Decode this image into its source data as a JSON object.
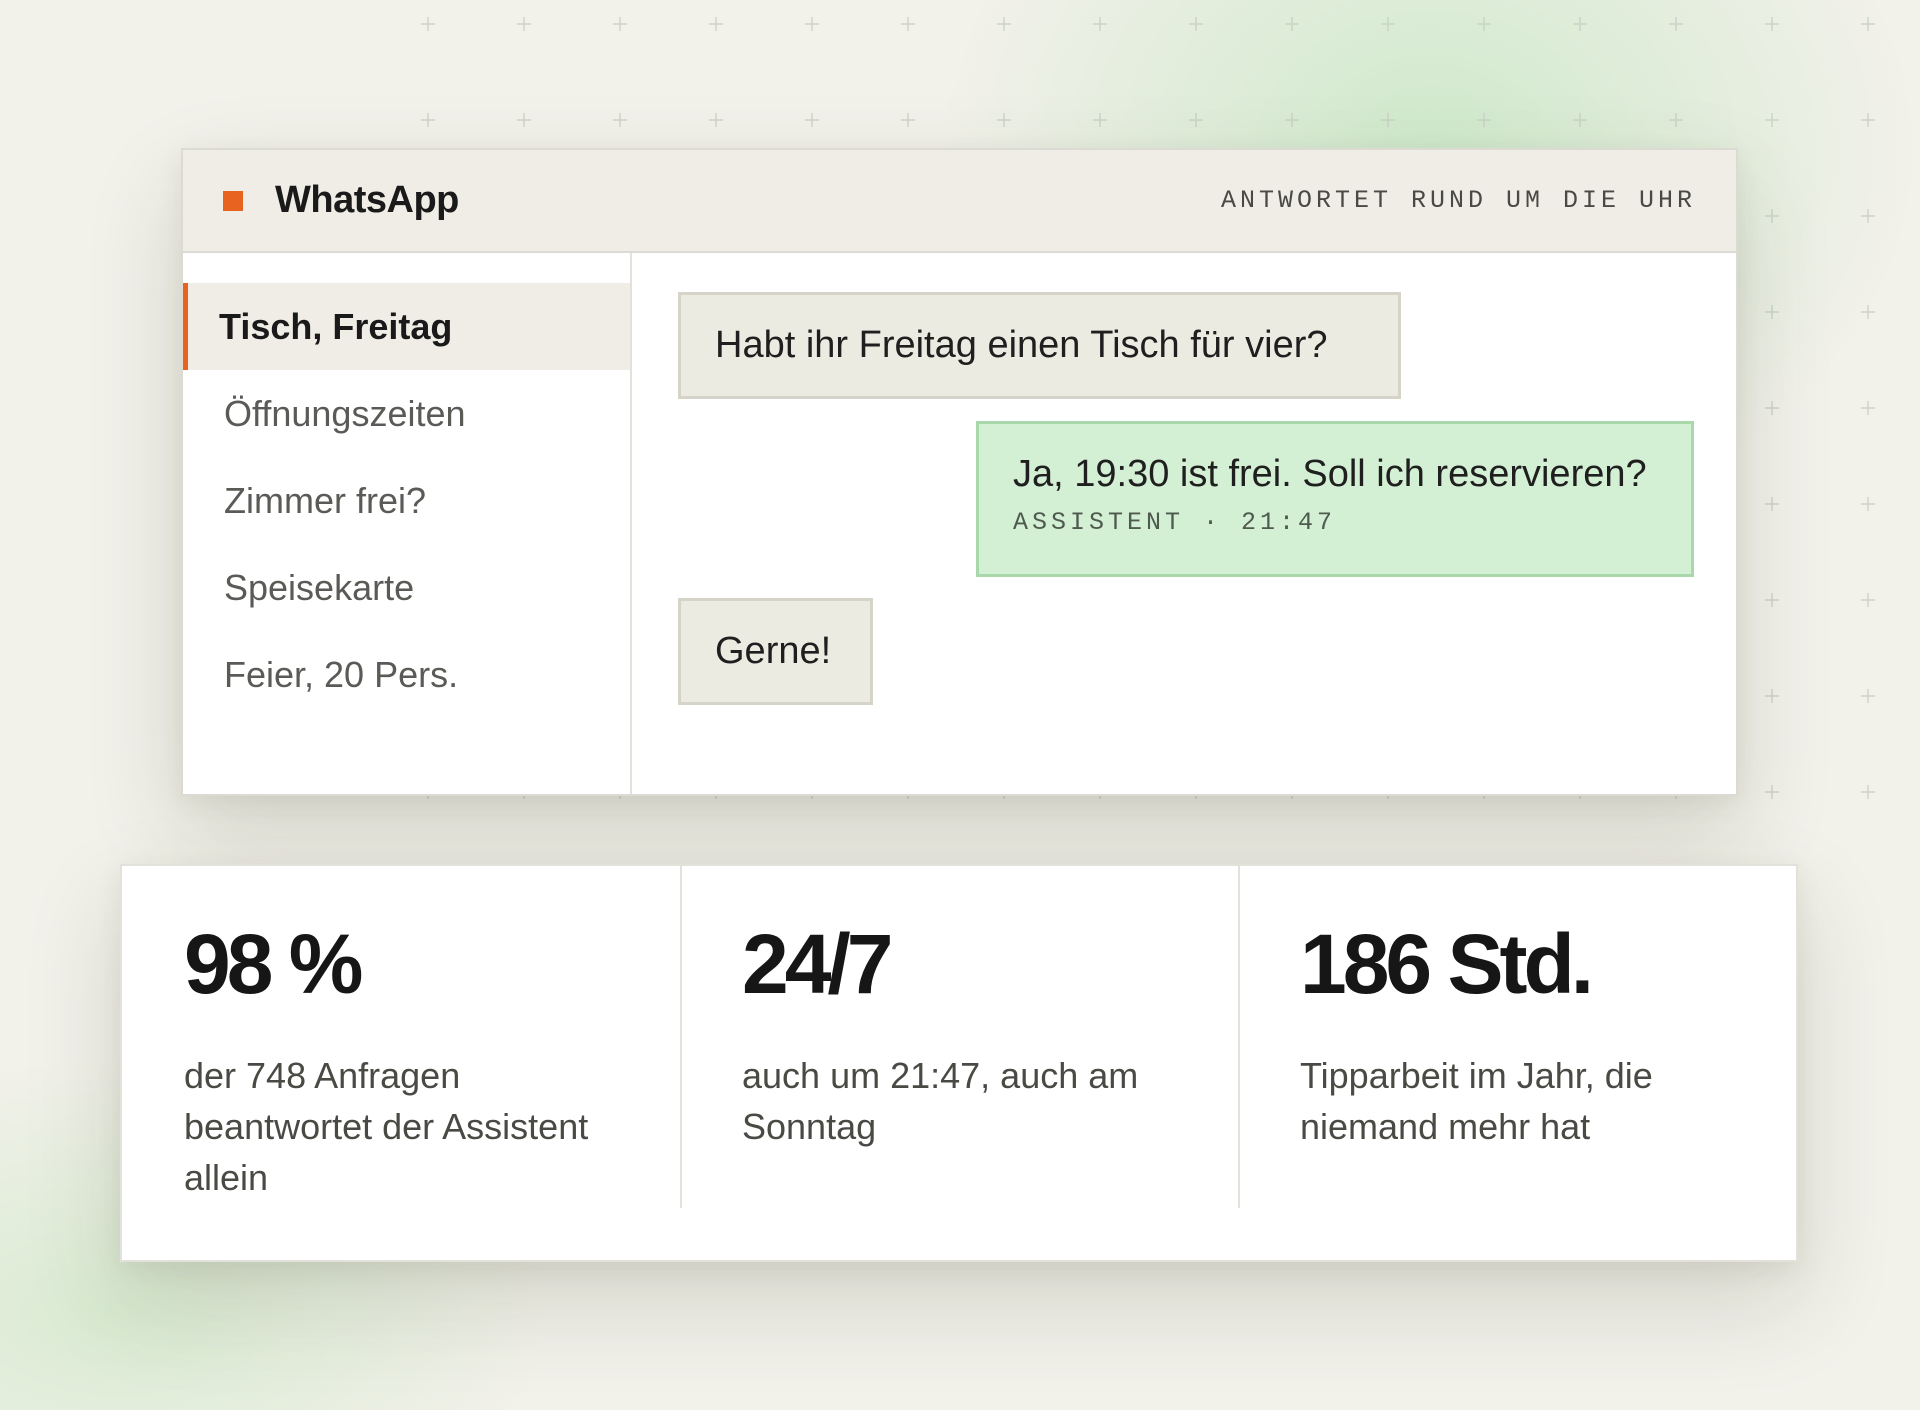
{
  "chat": {
    "app_name": "WhatsApp",
    "status": "ANTWORTET RUND UM DIE UHR",
    "brand_color": "#e8631f",
    "conversations": [
      {
        "label": "Tisch, Freitag",
        "active": true
      },
      {
        "label": "Öffnungszeiten",
        "active": false
      },
      {
        "label": "Zimmer frei?",
        "active": false
      },
      {
        "label": "Speisekarte",
        "active": false
      },
      {
        "label": "Feier, 20 Pers.",
        "active": false
      }
    ],
    "messages": [
      {
        "direction": "incoming",
        "text": "Habt ihr Freitag einen Tisch für vier?"
      },
      {
        "direction": "outgoing",
        "text": "Ja, 19:30 ist frei. Soll ich reservieren?",
        "meta": "ASSISTENT · 21:47"
      },
      {
        "direction": "incoming",
        "text": "Gerne!"
      }
    ]
  },
  "stats": [
    {
      "value": "98 %",
      "description": "der 748 Anfragen beantwortet der Assistent allein"
    },
    {
      "value": "24/7",
      "description": "auch um 21:47, auch am Sonntag"
    },
    {
      "value": "186 Std.",
      "description": "Tipparbeit im Jahr, die niemand mehr hat"
    }
  ]
}
